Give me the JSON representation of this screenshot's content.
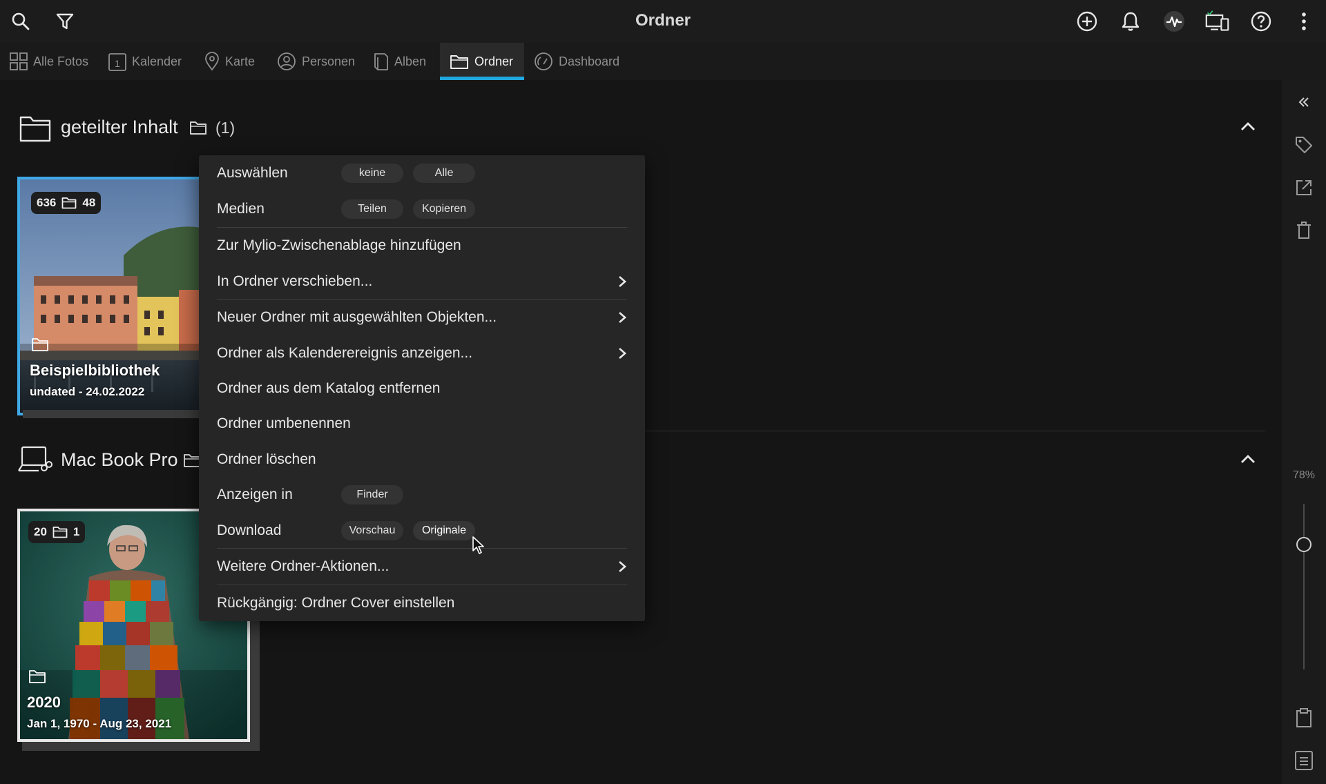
{
  "app": {
    "title": "Ordner"
  },
  "tabs": [
    {
      "label": "Alle Fotos",
      "icon": "grid-icon"
    },
    {
      "label": "Kalender",
      "icon": "calendar-icon"
    },
    {
      "label": "Karte",
      "icon": "map-pin-icon"
    },
    {
      "label": "Personen",
      "icon": "person-icon"
    },
    {
      "label": "Alben",
      "icon": "album-icon"
    },
    {
      "label": "Ordner",
      "icon": "folder-icon",
      "active": true
    },
    {
      "label": "Dashboard",
      "icon": "gauge-icon"
    }
  ],
  "sections": [
    {
      "title": "geteilter Inhalt",
      "count": "(1)"
    },
    {
      "title": "Mac Book Pro"
    }
  ],
  "cards": [
    {
      "photos": "636",
      "folders": "48",
      "name": "Beispielbibliothek",
      "date": "undated - 24.02.2022"
    },
    {
      "photos": "20",
      "folders": "1",
      "name": "2020",
      "date": "Jan 1, 1970 - Aug 23, 2021"
    }
  ],
  "menu": {
    "select_label": "Auswählen",
    "select_none": "keine",
    "select_all": "Alle",
    "media_label": "Medien",
    "media_share": "Teilen",
    "media_copy": "Kopieren",
    "add_clipboard": "Zur Mylio-Zwischenablage hinzufügen",
    "move_to_folder": "In Ordner verschieben...",
    "new_folder": "Neuer Ordner mit ausgewählten Objekten...",
    "show_calendar": "Ordner als Kalenderereignis anzeigen...",
    "remove_catalog": "Ordner aus dem Katalog entfernen",
    "rename": "Ordner umbenennen",
    "delete": "Ordner löschen",
    "show_in_label": "Anzeigen in",
    "show_in_finder": "Finder",
    "download_label": "Download",
    "download_preview": "Vorschau",
    "download_originals": "Originale",
    "more_actions": "Weitere Ordner-Aktionen...",
    "undo": "Rückgängig: Ordner Cover einstellen"
  },
  "sidebar": {
    "zoom": "78%"
  },
  "colors": {
    "accent": "#1fa8e0",
    "background": "#151515",
    "menu": "#262626"
  }
}
